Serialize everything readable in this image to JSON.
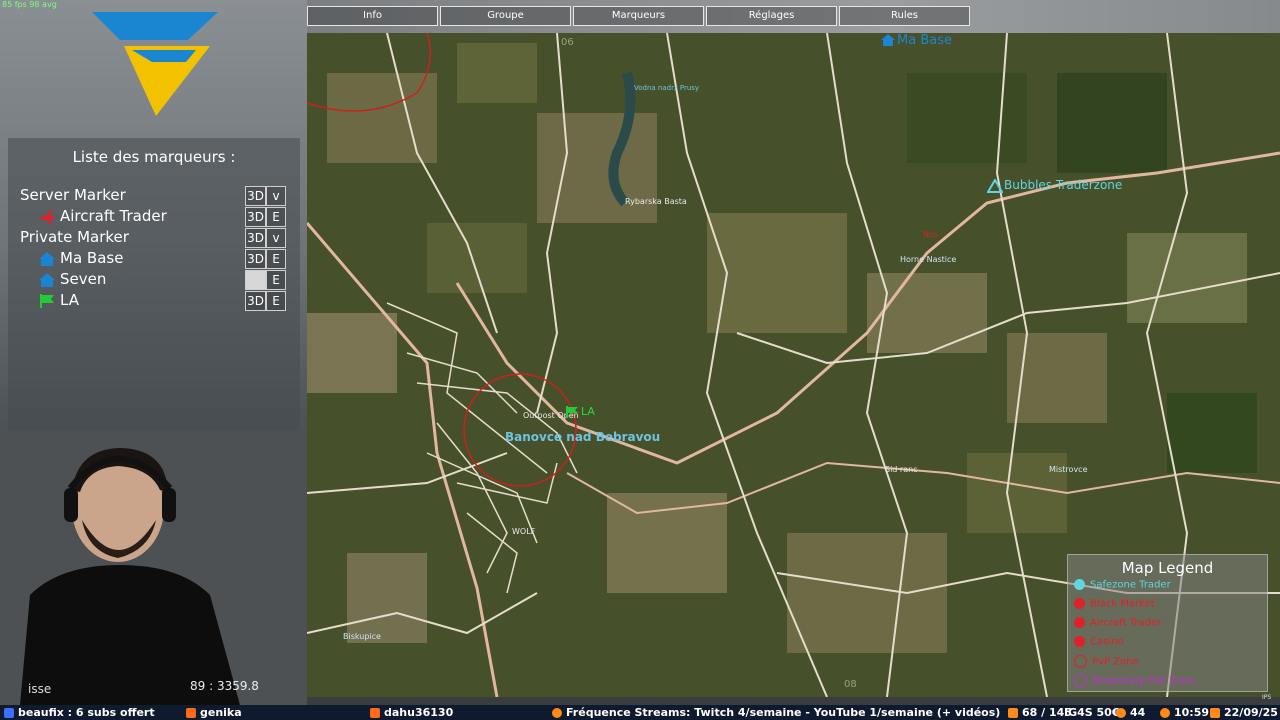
{
  "overlay": {
    "fps": "85 fps     98 avg"
  },
  "tabs": [
    {
      "label": "Info"
    },
    {
      "label": "Groupe"
    },
    {
      "label": "Marqueurs"
    },
    {
      "label": "Réglages"
    },
    {
      "label": "Rules"
    }
  ],
  "markers": {
    "title": "Liste des marqueurs :",
    "btn_3d": "3D",
    "btn_v": "v",
    "btn_e": "E",
    "server_group": "Server Marker",
    "aircraft_trader": "Aircraft Trader",
    "private_group": "Private Marker",
    "ma_base": "Ma Base",
    "seven": "Seven",
    "la": "LA"
  },
  "map": {
    "labels": {
      "ma_base": "Ma Base",
      "bubbles": "Bubbles Traderzone",
      "rybarska": "Rybarska Basta",
      "vodna": "Vodna nadrz Prusy",
      "horne": "Horne Nastice",
      "bn": "Banovce nad Bebravou",
      "outpost": "Outpost Open",
      "la": "LA",
      "wolf": "WOLF",
      "biskupice": "Biskupice",
      "sid": "Sid ranc",
      "mistr": "Mistrovce",
      "red": "Nos",
      "grid_06": "06",
      "grid_08": "08"
    }
  },
  "legend": {
    "title": "Map Legend",
    "items": [
      {
        "label": "Safezone Trader",
        "color": "#5fd6e0"
      },
      {
        "label": "Black Market",
        "color": "#e0202a"
      },
      {
        "label": "Aircraft Trader",
        "color": "#e0202a"
      },
      {
        "label": "Casino",
        "color": "#e0202a"
      },
      {
        "label": "PvP Zone",
        "color": "#e0202a"
      },
      {
        "label": "Temporary PvP Zone",
        "color": "#c030d0"
      }
    ]
  },
  "camera": {
    "left_text": "isse",
    "right_text": "89 : 3359.8"
  },
  "bottom_bar": {
    "subs": "beaufix : 6 subs offert",
    "genika": "genika",
    "dahu": "dahu36130",
    "freq": "Fréquence Streams: Twitch 4/semaine - YouTube 1/semaine (+ vidéos)",
    "count": "68 / 145",
    "ig": "IG4S 50€",
    "viewers": "44",
    "time": "10:59",
    "date": "22/09/25"
  },
  "colors": {
    "accent_yellow": "#f2c200",
    "accent_blue": "#1a86d1",
    "map_green": "#46502a",
    "road": "#d9c9b5"
  },
  "icons": [
    "logo-emblem",
    "plane-icon",
    "house-icon",
    "flag-icon",
    "check-icon",
    "shield-icon",
    "eye-icon",
    "clock-icon",
    "calendar-icon"
  ]
}
